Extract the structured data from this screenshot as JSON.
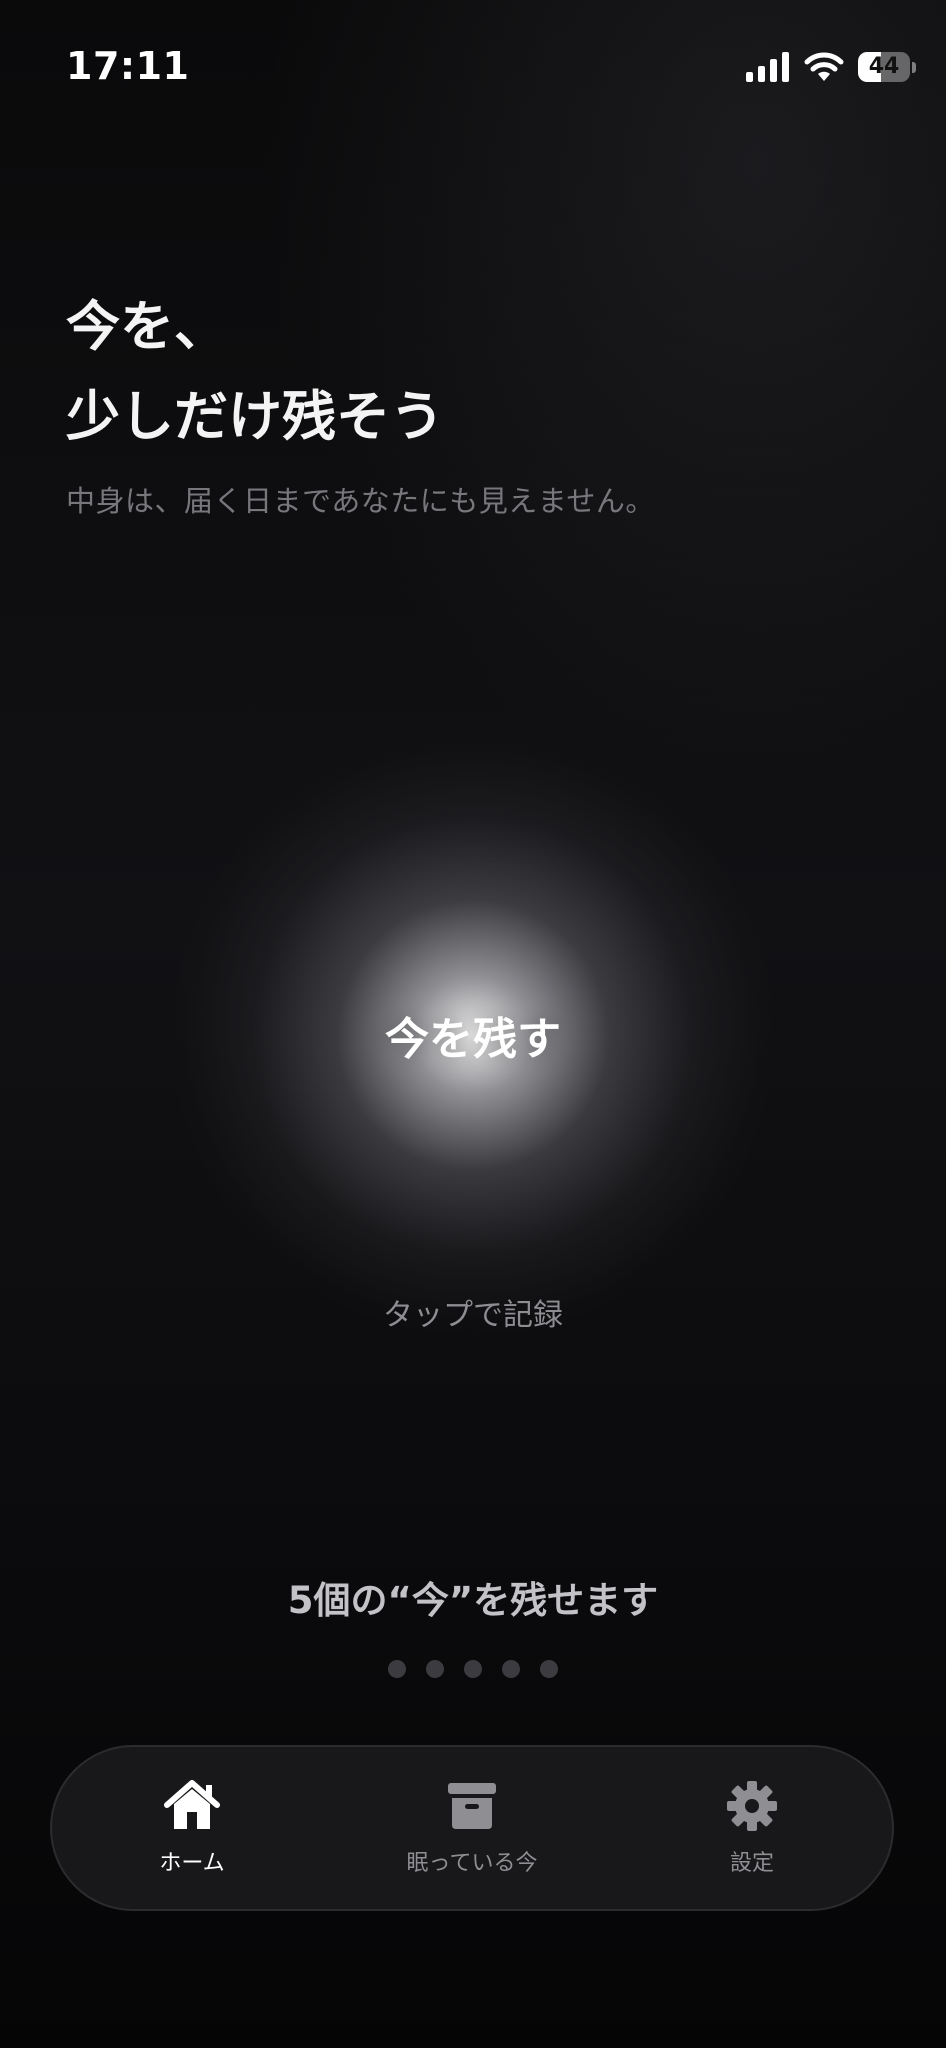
{
  "status_bar": {
    "time": "17:11",
    "battery_level": "44",
    "battery_fraction": 0.44
  },
  "header": {
    "title_line1": "今を、",
    "title_line2": "少しだけ残そう",
    "subtitle": "中身は、届く日まであなたにも見えません。"
  },
  "record": {
    "button_label": "今を残す",
    "hint": "タップで記録"
  },
  "remaining": {
    "text": "5個の“今”を残せます",
    "count": 5
  },
  "tab_bar": {
    "tabs": [
      {
        "label": "ホーム",
        "icon": "house-icon",
        "active": true
      },
      {
        "label": "眠っている今",
        "icon": "archive-box-icon",
        "active": false
      },
      {
        "label": "設定",
        "icon": "gear-icon",
        "active": false
      }
    ]
  },
  "colors": {
    "background": "#0b0b0d",
    "tab_bar_bg": "#18181a",
    "active_tab": "#ffffff",
    "inactive_tab": "#8e8e93",
    "dot": "#3c3c40"
  }
}
